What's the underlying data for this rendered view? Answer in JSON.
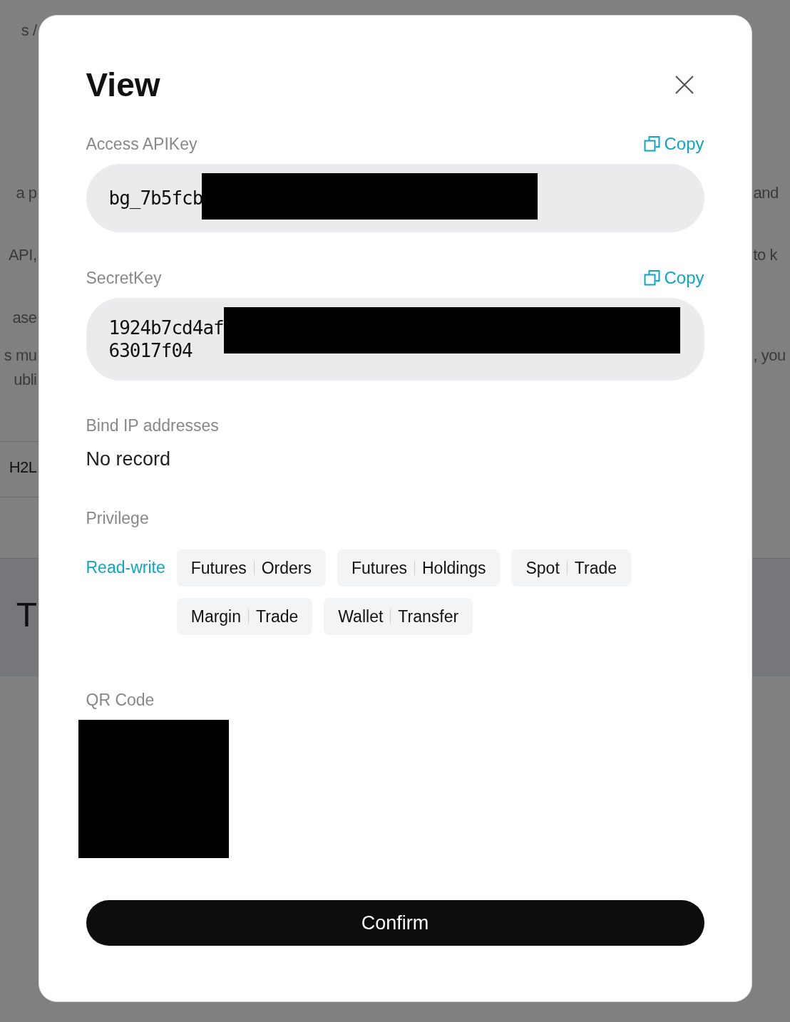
{
  "backdrop": {
    "left": [
      "s  /",
      "a p",
      "API,",
      "ase",
      "s mu",
      "ubli",
      "H2L",
      "T"
    ],
    "right": [
      "and",
      "to k",
      ", you"
    ]
  },
  "dialog": {
    "title": "View",
    "fields": [
      {
        "label": "Access APIKey",
        "copy": "Copy",
        "lines": [
          "bg_7b5fcb"
        ],
        "redacted": true
      },
      {
        "label": "SecretKey",
        "copy": "Copy",
        "lines": [
          "1924b7cd4af",
          "63017f04"
        ],
        "redacted": true
      }
    ],
    "bind_ip": {
      "label": "Bind IP addresses",
      "value": "No record"
    },
    "privilege": {
      "label": "Privilege",
      "mode": "Read-write",
      "tags": [
        [
          "Futures",
          "Orders"
        ],
        [
          "Futures",
          "Holdings"
        ],
        [
          "Spot",
          "Trade"
        ],
        [
          "Margin",
          "Trade"
        ],
        [
          "Wallet",
          "Transfer"
        ]
      ]
    },
    "qr": {
      "label": "QR Code",
      "redacted": true
    },
    "confirm": "Confirm"
  }
}
